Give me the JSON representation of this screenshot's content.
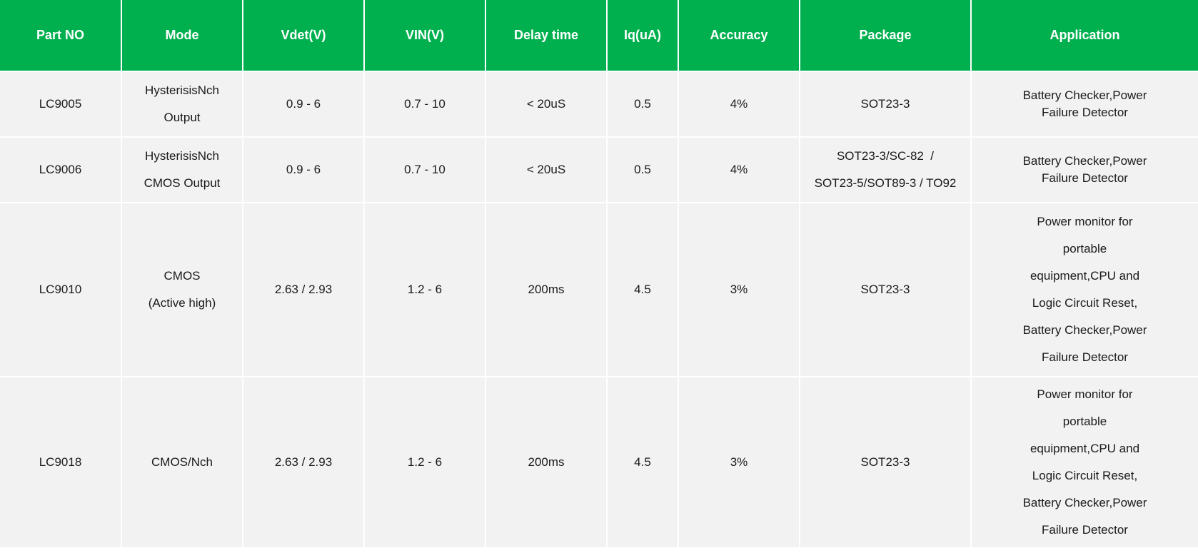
{
  "table": {
    "headers": [
      "Part NO",
      "Mode",
      "Vdet(V)",
      "VIN(V)",
      "Delay time",
      "Iq(uA)",
      "Accuracy",
      "Package",
      "Application"
    ],
    "rows": [
      {
        "part_no": "LC9005",
        "mode": [
          "HysterisisNch",
          "Output"
        ],
        "vdet": "0.9 - 6",
        "vin": "0.7 - 10",
        "delay": "< 20uS",
        "iq": "0.5",
        "accuracy": "4%",
        "package": [
          "SOT23-3"
        ],
        "application": [
          "Battery Checker,Power",
          "Failure Detector"
        ]
      },
      {
        "part_no": "LC9006",
        "mode": [
          "HysterisisNch",
          "CMOS Output"
        ],
        "vdet": "0.9 - 6",
        "vin": "0.7 - 10",
        "delay": "< 20uS",
        "iq": "0.5",
        "accuracy": "4%",
        "package": [
          "SOT23-3/SC-82  /",
          "SOT23-5/SOT89-3 / TO92"
        ],
        "application": [
          "Battery Checker,Power",
          "Failure Detector"
        ]
      },
      {
        "part_no": "LC9010",
        "mode": [
          "CMOS",
          "(Active high)"
        ],
        "vdet": "2.63 / 2.93",
        "vin": "1.2 - 6",
        "delay": "200ms",
        "iq": "4.5",
        "accuracy": "3%",
        "package": [
          "SOT23-3"
        ],
        "application": [
          "Power monitor for",
          "portable",
          "equipment,CPU and",
          "Logic Circuit Reset,",
          "Battery Checker,Power",
          "Failure Detector"
        ]
      },
      {
        "part_no": "LC9018",
        "mode": [
          "CMOS/Nch"
        ],
        "vdet": "2.63 / 2.93",
        "vin": "1.2 - 6",
        "delay": "200ms",
        "iq": "4.5",
        "accuracy": "3%",
        "package": [
          "SOT23-3"
        ],
        "application": [
          "Power monitor for",
          "portable",
          "equipment,CPU and",
          "Logic Circuit Reset,",
          "Battery Checker,Power",
          "Failure Detector"
        ]
      }
    ]
  },
  "colors": {
    "header_bg": "#00b04f",
    "header_text": "#ffffff",
    "row_bg": "#f2f2f2",
    "row_text": "#1a1a1a"
  }
}
